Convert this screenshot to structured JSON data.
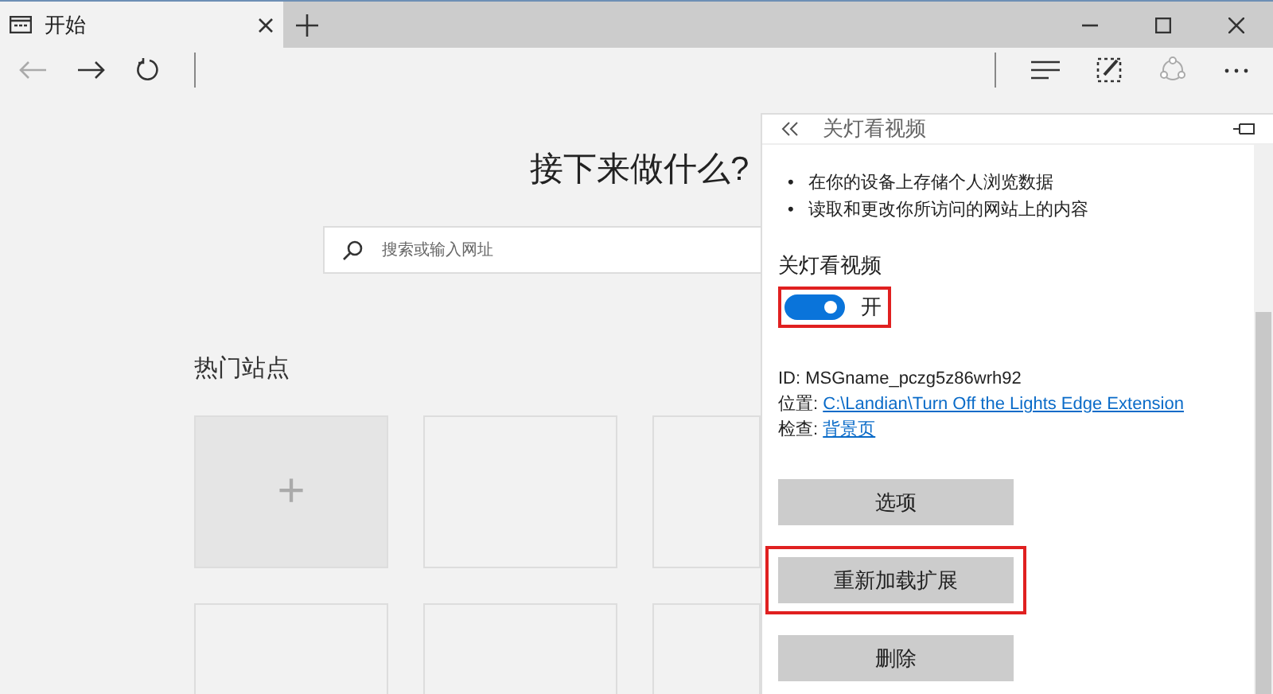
{
  "tab": {
    "title": "开始",
    "selected": true
  },
  "page": {
    "heading": "接下来做什么?",
    "search": {
      "placeholder": "搜索或输入网址"
    },
    "top_sites_title": "热门站点",
    "tiles": [
      {
        "kind": "add",
        "label": "+"
      },
      {
        "kind": "empty"
      },
      {
        "kind": "empty"
      },
      {
        "kind": "empty"
      },
      {
        "kind": "empty"
      },
      {
        "kind": "empty"
      }
    ]
  },
  "panel": {
    "title": "关灯看视频",
    "permissions": [
      {
        "marker": "•",
        "text": "在你的设备上存储个人浏览数据"
      },
      {
        "marker": "•",
        "text": "读取和更改你所访问的网站上的内容"
      }
    ],
    "toggle": {
      "label": "关灯看视频",
      "on": true,
      "state_text": "开",
      "highlighted": true
    },
    "details": [
      {
        "label": "ID: ",
        "value": "MSGname_pczg5z86wrh92",
        "kind": "text"
      },
      {
        "label": "位置: ",
        "value": "C:\\Landian\\Turn Off the Lights Edge Extension",
        "kind": "link"
      },
      {
        "label": "检查: ",
        "value": "背景页",
        "kind": "link"
      }
    ],
    "buttons": [
      {
        "label": "选项",
        "highlighted": false
      },
      {
        "label": "重新加载扩展",
        "highlighted": true
      },
      {
        "label": "删除",
        "highlighted": false
      }
    ]
  }
}
